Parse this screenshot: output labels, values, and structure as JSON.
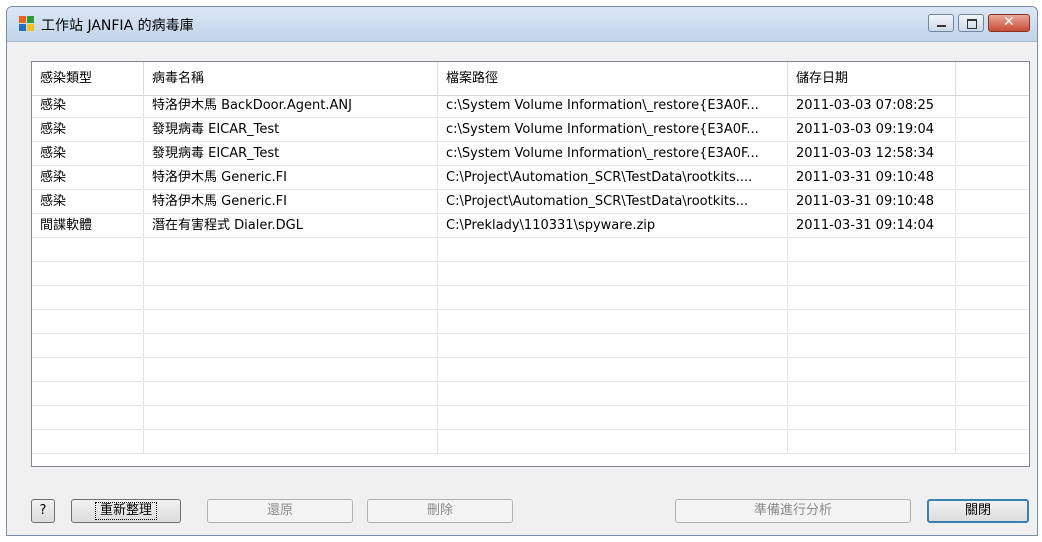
{
  "window": {
    "title": "工作站 JANFIA 的病毒庫"
  },
  "columns": [
    "感染類型",
    "病毒名稱",
    "檔案路徑",
    "儲存日期",
    ""
  ],
  "rows": [
    [
      "感染",
      "特洛伊木馬 BackDoor.Agent.ANJ",
      "c:\\System Volume Information\\_restore{E3A0F...",
      "2011-03-03 07:08:25"
    ],
    [
      "感染",
      "發現病毒 EICAR_Test",
      "c:\\System Volume Information\\_restore{E3A0F...",
      "2011-03-03 09:19:04"
    ],
    [
      "感染",
      "發現病毒 EICAR_Test",
      "c:\\System Volume Information\\_restore{E3A0F...",
      "2011-03-03 12:58:34"
    ],
    [
      "感染",
      "特洛伊木馬 Generic.FI",
      "C:\\Project\\Automation_SCR\\TestData\\rootkits....",
      "2011-03-31 09:10:48"
    ],
    [
      "感染",
      "特洛伊木馬 Generic.FI",
      "C:\\Project\\Automation_SCR\\TestData\\rootkits...",
      "2011-03-31 09:10:48"
    ],
    [
      "間諜軟體",
      "潛在有害程式 Dialer.DGL",
      "C:\\Preklady\\110331\\spyware.zip",
      "2011-03-31 09:14:04"
    ],
    [
      "",
      "",
      "",
      ""
    ],
    [
      "",
      "",
      "",
      ""
    ],
    [
      "",
      "",
      "",
      ""
    ],
    [
      "",
      "",
      "",
      ""
    ],
    [
      "",
      "",
      "",
      ""
    ],
    [
      "",
      "",
      "",
      ""
    ],
    [
      "",
      "",
      "",
      ""
    ],
    [
      "",
      "",
      "",
      ""
    ],
    [
      "",
      "",
      "",
      ""
    ]
  ],
  "buttons": {
    "help": "?",
    "reorganize": "重新整理",
    "restore": "還原",
    "delete": "刪除",
    "analyze": "準備進行分析",
    "close": "關閉"
  },
  "icons": {
    "app": "avg-logo-icon",
    "minimize": "minimize-icon",
    "maximize": "maximize-icon",
    "close": "close-icon"
  }
}
